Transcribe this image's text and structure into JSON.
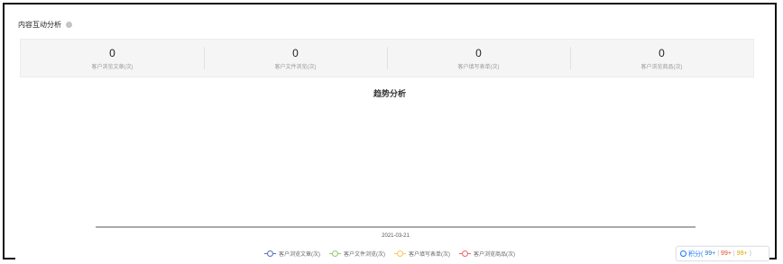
{
  "section": {
    "title": "内容互动分析"
  },
  "stats": [
    {
      "value": "0",
      "label": "客户浏览文章(次)"
    },
    {
      "value": "0",
      "label": "客户文件浏览(次)"
    },
    {
      "value": "0",
      "label": "客户填写表单(次)"
    },
    {
      "value": "0",
      "label": "客户浏览商品(次)"
    }
  ],
  "chart_data": {
    "type": "line",
    "title": "趋势分析",
    "categories": [
      "2021-03-21"
    ],
    "series": [
      {
        "name": "客户浏览文章(次)",
        "color": "#5470c6",
        "values": [
          0
        ]
      },
      {
        "name": "客户文件浏览(次)",
        "color": "#91cc75",
        "values": [
          0
        ]
      },
      {
        "name": "客户填写表单(次)",
        "color": "#fac858",
        "values": [
          0
        ]
      },
      {
        "name": "客户浏览商品(次)",
        "color": "#ee6666",
        "values": [
          0
        ]
      }
    ],
    "legend_position": "bottom",
    "grid": false
  },
  "widget": {
    "label": "积分(",
    "v1": "99+",
    "v2": "99+",
    "v3": "99+",
    "end": ")"
  }
}
